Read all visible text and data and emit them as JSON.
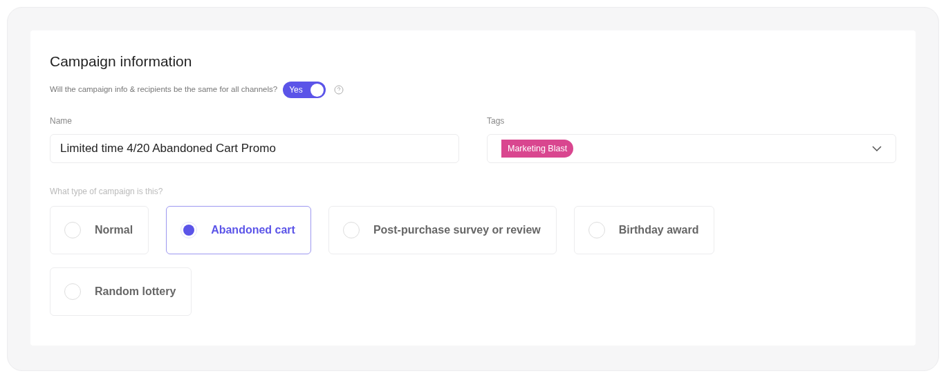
{
  "section": {
    "title": "Campaign information"
  },
  "same_info": {
    "question": "Will the campaign info & recipients be the same for all channels?",
    "toggle_label": "Yes",
    "on": true
  },
  "name_field": {
    "label": "Name",
    "value": "Limited time 4/20 Abandoned Cart Promo"
  },
  "tags_field": {
    "label": "Tags",
    "tags": [
      {
        "label": "Marketing Blast",
        "color": "#d9468f"
      }
    ]
  },
  "campaign_type": {
    "label": "What type of campaign is this?",
    "options": [
      {
        "label": "Normal",
        "selected": false
      },
      {
        "label": "Abandoned cart",
        "selected": true
      },
      {
        "label": "Post-purchase survey or review",
        "selected": false
      },
      {
        "label": "Birthday award",
        "selected": false
      },
      {
        "label": "Random lottery",
        "selected": false
      }
    ]
  }
}
